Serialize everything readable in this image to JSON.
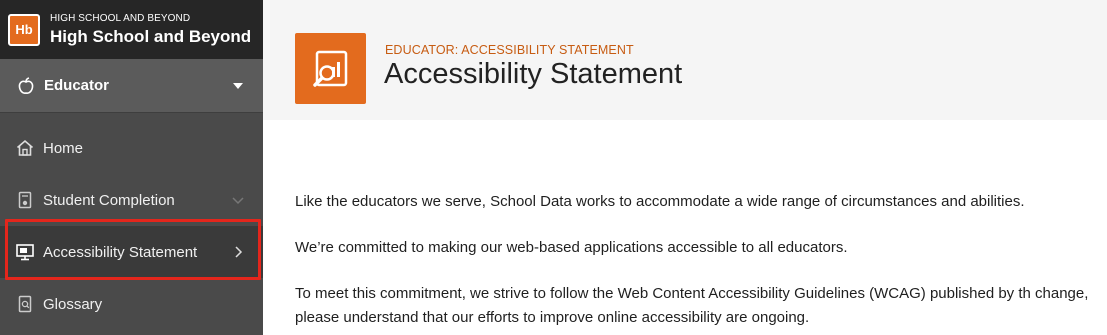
{
  "brand": {
    "logo_text": "Hb",
    "subtitle": "HIGH SCHOOL AND BEYOND",
    "title": "High School and Beyond"
  },
  "role": {
    "label": "Educator",
    "icon": "apple-icon"
  },
  "nav": {
    "items": [
      {
        "label": "Home",
        "icon": "home-icon"
      },
      {
        "label": "Student Completion",
        "icon": "document-icon"
      },
      {
        "label": "Accessibility Statement",
        "icon": "monitor-icon",
        "active": true
      },
      {
        "label": "Glossary",
        "icon": "book-icon"
      }
    ]
  },
  "header": {
    "eyebrow": "EDUCATOR: ACCESSIBILITY STATEMENT",
    "title": "Accessibility Statement",
    "icon": "magnifier-chart-icon"
  },
  "content": {
    "paragraphs": [
      "Like the educators we serve, School Data works to accommodate a wide range of circumstances and abilities.",
      "We’re committed to making our web-based applications accessible to all educators.",
      "To meet this commitment, we strive to follow the Web Content Accessibility Guidelines (WCAG) published by th change, please understand that our efforts to improve online accessibility are ongoing."
    ]
  },
  "colors": {
    "accent": "#e36b1e",
    "sidebar_bg": "#4a4a4a",
    "brand_bg": "#262626",
    "highlight": "#e4261c"
  }
}
